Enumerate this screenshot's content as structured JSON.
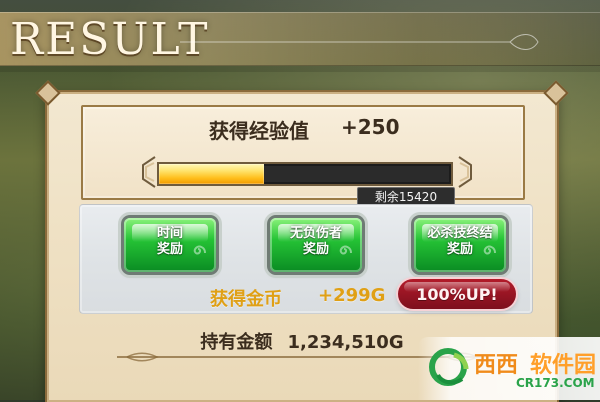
{
  "header": {
    "title": "RESULT"
  },
  "exp": {
    "label": "获得经验值",
    "gain": "+250",
    "remaining_text": "剩余15420",
    "fill_fraction": 0.36
  },
  "bonuses": [
    {
      "label": "时间\n奖励"
    },
    {
      "label": "无负伤者\n奖励"
    },
    {
      "label": "必杀技终结\n奖励"
    }
  ],
  "coins": {
    "label": "获得金币",
    "gain": "+299G",
    "boost": "100%UP!"
  },
  "holdings": {
    "label": "持有金额",
    "value": "1,234,510G"
  },
  "watermark": {
    "brand_left": "西西",
    "brand_right": "软件园",
    "domain": "CR173.COM"
  },
  "colors": {
    "coin_text": "#e0a015",
    "badge_red": "#b31b2a",
    "button_green": "#25c335"
  }
}
